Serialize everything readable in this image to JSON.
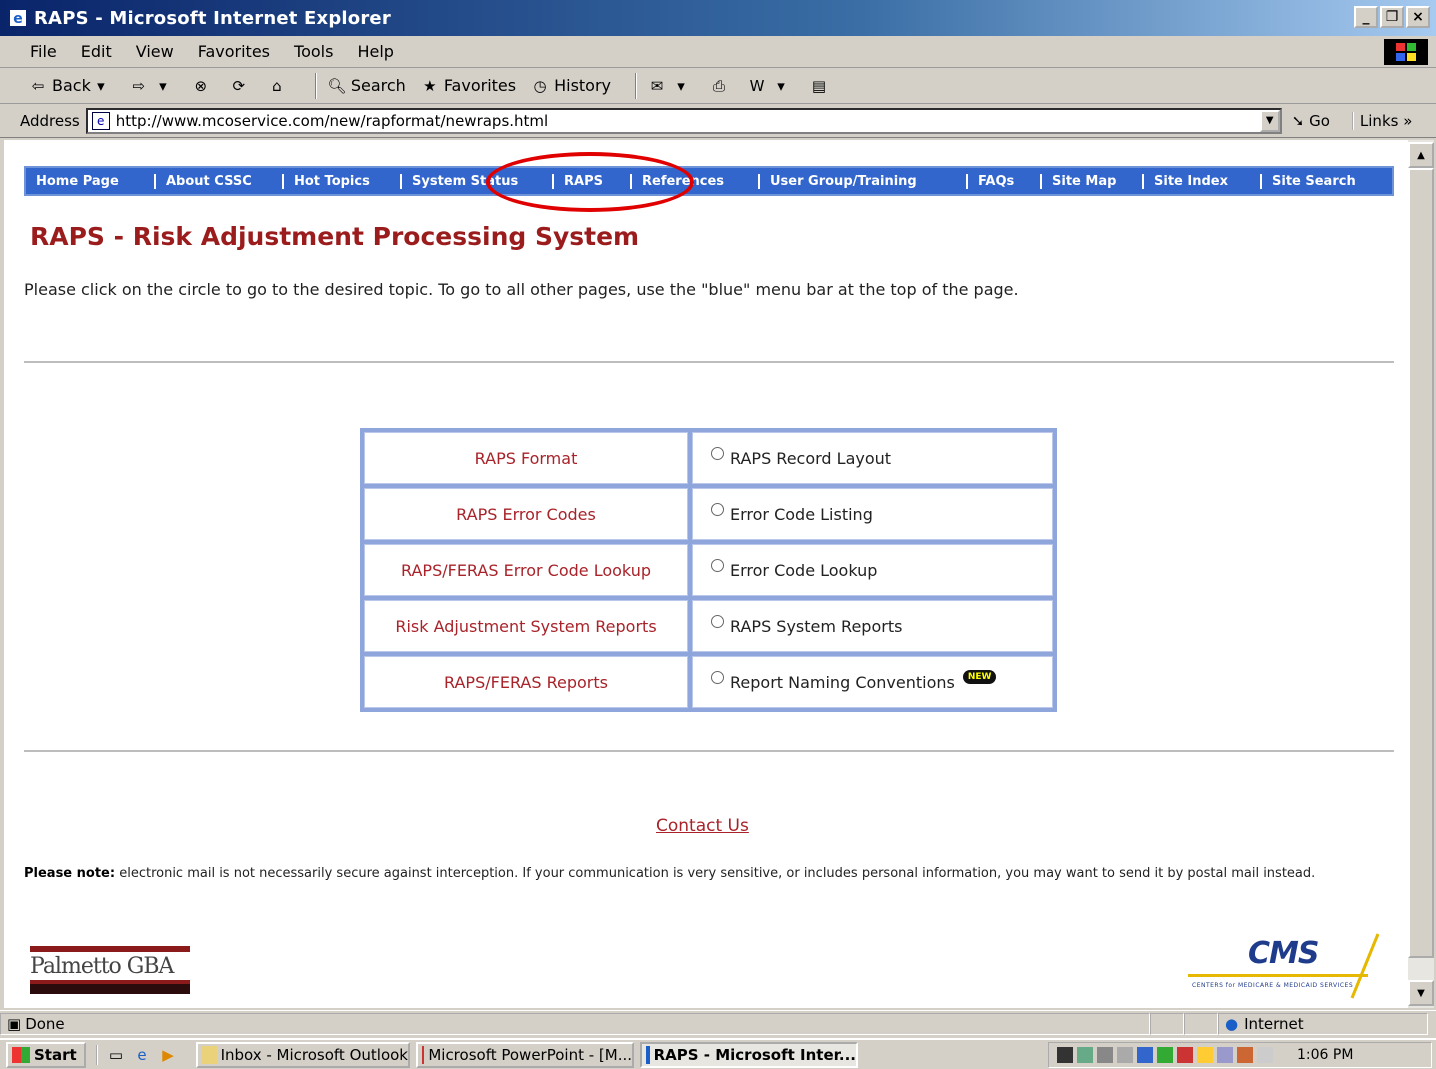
{
  "window": {
    "title": "RAPS - Microsoft Internet Explorer",
    "buttons": [
      "_",
      " □",
      "×"
    ]
  },
  "menu": [
    "File",
    "Edit",
    "View",
    "Favorites",
    "Tools",
    "Help"
  ],
  "toolbar": {
    "back": "Back",
    "search": "Search",
    "favorites": "Favorites",
    "history": "History"
  },
  "address": {
    "label": "Address",
    "url": "http://www.mcoservice.com/new/rapformat/newraps.html",
    "go": "Go",
    "links": "Links"
  },
  "nav": [
    "Home Page",
    "About CSSC",
    "Hot Topics",
    "System Status",
    "RAPS",
    "References",
    "User Group/Training",
    "FAQs",
    "Site Map",
    "Site Index",
    "Site Search"
  ],
  "page": {
    "title": "RAPS - Risk Adjustment Processing System",
    "intro": "Please click on the circle to go to the desired topic. To go to all other pages, use the \"blue\" menu bar at the top of the page.",
    "topics": [
      {
        "left": "RAPS Format",
        "right": "RAPS Record Layout"
      },
      {
        "left": "RAPS Error Codes",
        "right": "Error Code Listing"
      },
      {
        "left": "RAPS/FERAS Error Code Lookup",
        "right": "Error Code Lookup"
      },
      {
        "left": "Risk Adjustment System Reports",
        "right": "RAPS System Reports"
      },
      {
        "left": "RAPS/FERAS Reports",
        "right": "Report Naming Conventions",
        "badge": "NEW"
      }
    ],
    "contact": "Contact Us",
    "note_bold": "Please note:",
    "note_text": " electronic mail is not necessarily secure against interception. If your communication is very sensitive, or includes personal information, you may want to send it by postal mail instead.",
    "logo_left": "Palmetto GBA",
    "logo_right": "CMS",
    "logo_right_tag": "CENTERS for MEDICARE & MEDICAID SERVICES"
  },
  "status": {
    "text": "Done",
    "zone": "Internet"
  },
  "taskbar": {
    "start": "Start",
    "tasks": [
      {
        "label": "Inbox - Microsoft Outlook",
        "active": false
      },
      {
        "label": "Microsoft PowerPoint - [M...",
        "active": false
      },
      {
        "label": "RAPS - Microsoft Inter...",
        "active": true
      }
    ],
    "clock": "1:06 PM"
  },
  "colors": {
    "nav_bg": "#3366cc",
    "title_red": "#9b1c1c",
    "link_red": "#a8232a",
    "highlight": "#e00000"
  }
}
